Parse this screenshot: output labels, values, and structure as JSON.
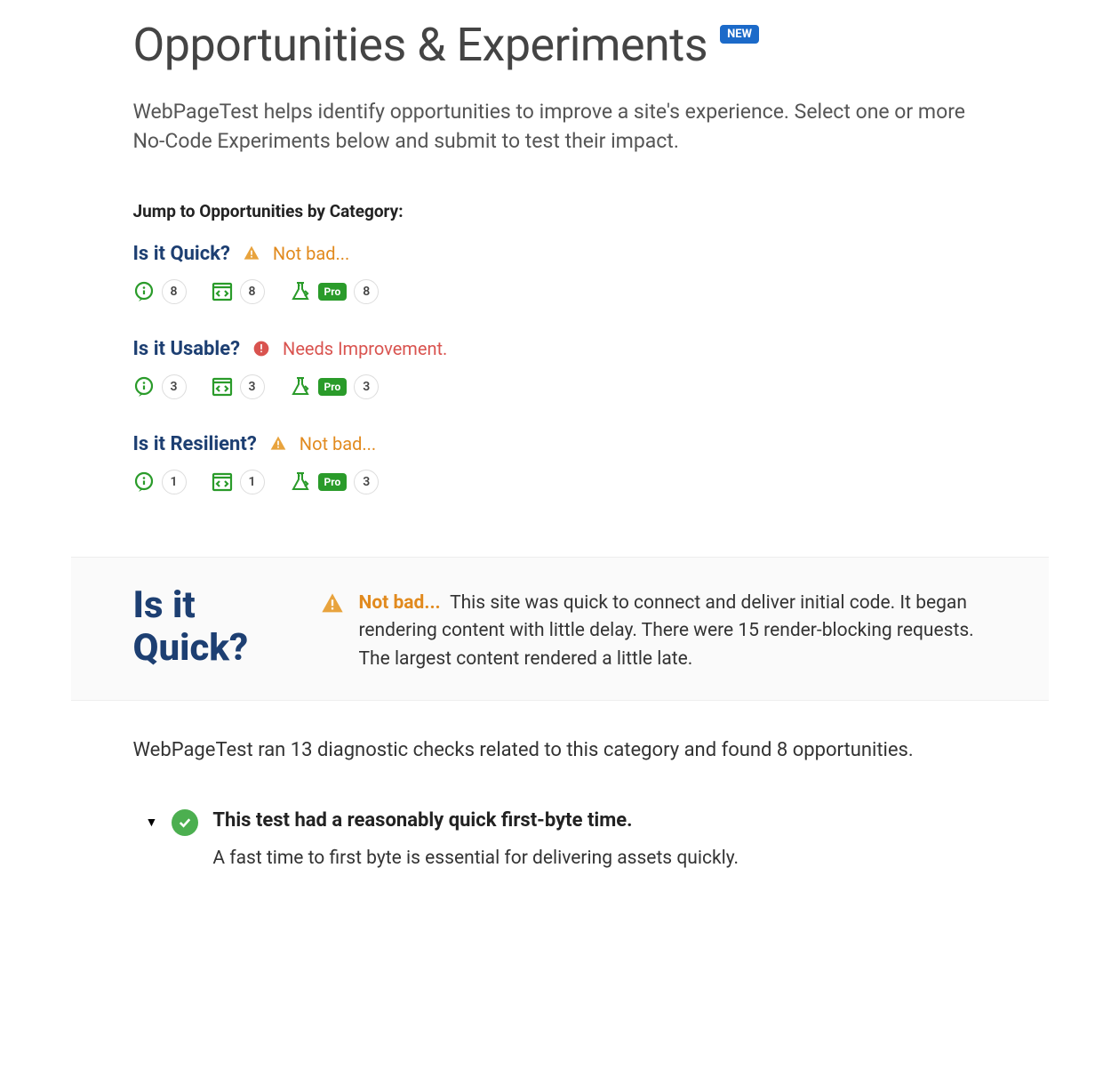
{
  "header": {
    "title": "Opportunities & Experiments",
    "badge": "NEW",
    "intro": "WebPageTest helps identify opportunities to improve a site's experience. Select one or more No-Code Experiments below and submit to test their impact."
  },
  "jump": {
    "label": "Jump to Opportunities by Category:",
    "categories": [
      {
        "name": "Is it Quick?",
        "status": "warn",
        "status_text": "Not bad...",
        "tips": "8",
        "code": "8",
        "pro_label": "Pro",
        "pro": "8"
      },
      {
        "name": "Is it Usable?",
        "status": "bad",
        "status_text": "Needs Improvement.",
        "tips": "3",
        "code": "3",
        "pro_label": "Pro",
        "pro": "3"
      },
      {
        "name": "Is it Resilient?",
        "status": "warn",
        "status_text": "Not bad...",
        "tips": "1",
        "code": "1",
        "pro_label": "Pro",
        "pro": "3"
      }
    ]
  },
  "section": {
    "title": "Is it Quick?",
    "lead": "Not bad...",
    "desc": "This site was quick to connect and deliver initial code. It began rendering content with little delay. There were 15 render-blocking requests. The largest content rendered a little late.",
    "diagnostic": "WebPageTest ran 13 diagnostic checks related to this category and found 8 opportunities.",
    "checks": [
      {
        "title": "This test had a reasonably quick first-byte time.",
        "sub": "A fast time to first byte is essential for delivering assets quickly."
      }
    ]
  }
}
